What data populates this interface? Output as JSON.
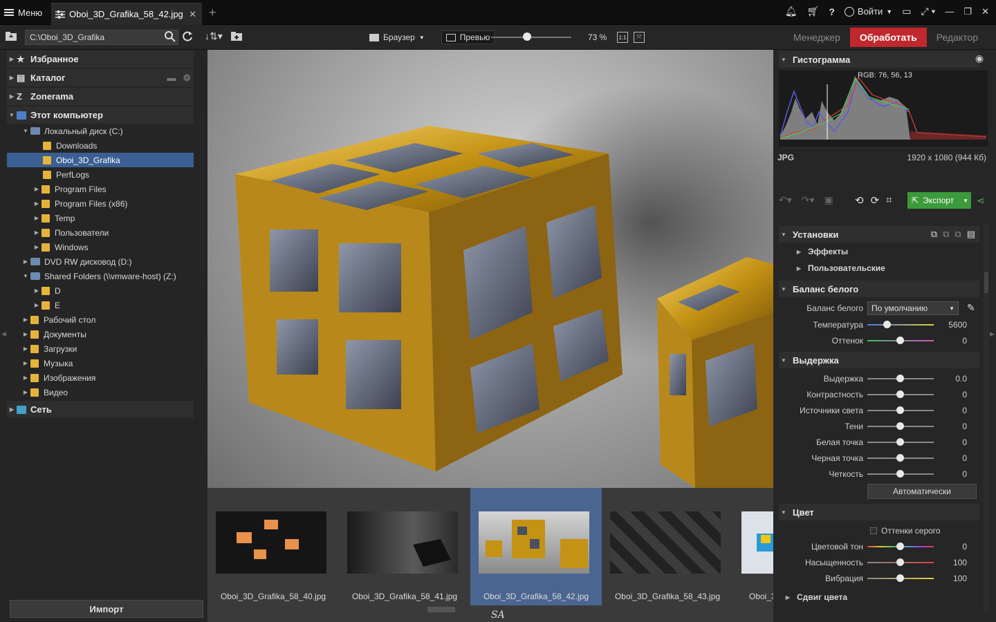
{
  "topbar": {
    "menu_label": "Меню",
    "tab_title": "Oboi_3D_Grafika_58_42.jpg",
    "close_glyph": "✕",
    "new_tab_glyph": "+",
    "login_label": "Войти"
  },
  "toolbar": {
    "path_value": "C:\\Oboi_3D_Grafika",
    "browser_label": "Браузер",
    "preview_label": "Превью",
    "zoom_percent": 73,
    "zoom_label": "73 %",
    "one_to_one": "1:1",
    "modes": [
      "Менеджер",
      "Обработать",
      "Редактор"
    ]
  },
  "nav": {
    "sections": [
      "Избранное",
      "Каталог",
      "Zonerama",
      "Этот компьютер",
      "Сеть"
    ],
    "tree": [
      {
        "label": "Локальный диск (C:)"
      },
      {
        "label": "Downloads"
      },
      {
        "label": "Oboi_3D_Grafika"
      },
      {
        "label": "PerfLogs"
      },
      {
        "label": "Program Files"
      },
      {
        "label": "Program Files (x86)"
      },
      {
        "label": "Temp"
      },
      {
        "label": "Пользователи"
      },
      {
        "label": "Windows"
      },
      {
        "label": "DVD RW дисковод (D:)"
      },
      {
        "label": "Shared Folders (\\\\vmware-host) (Z:)"
      },
      {
        "label": "D"
      },
      {
        "label": "E"
      },
      {
        "label": "Рабочий стол"
      },
      {
        "label": "Документы"
      },
      {
        "label": "Загрузки"
      },
      {
        "label": "Музыка"
      },
      {
        "label": "Изображения"
      },
      {
        "label": "Видео"
      }
    ],
    "import_label": "Импорт"
  },
  "filmstrip": {
    "items": [
      "Oboi_3D_Grafika_58_40.jpg",
      "Oboi_3D_Grafika_58_41.jpg",
      "Oboi_3D_Grafika_58_42.jpg",
      "Oboi_3D_Grafika_58_43.jpg",
      "Oboi_3"
    ]
  },
  "signature": "SA",
  "right": {
    "histogram_title": "Гистограмма",
    "rgb_readout": "RGB: 76, 56, 13",
    "format": "JPG",
    "dimensions": "1920 x 1080 (944 Кб)",
    "export_label": "Экспорт",
    "presets_title": "Установки",
    "effects_label": "Эффекты",
    "custom_label": "Пользовательские",
    "wb_title": "Баланс белого",
    "wb_label": "Баланс белого",
    "wb_value": "По умолчанию",
    "temp_label": "Температура",
    "temp_value": "5600",
    "tint_label": "Оттенок",
    "tint_value": "0",
    "exposure_title": "Выдержка",
    "exposure_rows": [
      {
        "label": "Выдержка",
        "value": "0.0"
      },
      {
        "label": "Контрастность",
        "value": "0"
      },
      {
        "label": "Источники света",
        "value": "0"
      },
      {
        "label": "Тени",
        "value": "0"
      },
      {
        "label": "Белая точка",
        "value": "0"
      },
      {
        "label": "Черная точка",
        "value": "0"
      },
      {
        "label": "Четкость",
        "value": "0"
      }
    ],
    "auto_label": "Автоматически",
    "color_title": "Цвет",
    "grayscale_label": "Оттенки серого",
    "color_rows": [
      {
        "label": "Цветовой тон",
        "value": "0"
      },
      {
        "label": "Насыщенность",
        "value": "100"
      },
      {
        "label": "Вибрация",
        "value": "100"
      }
    ],
    "shift_title": "Сдвиг цвета"
  },
  "colors": {
    "accent_red": "#c0282d",
    "export_green": "#3b9a3b",
    "selection_blue": "#3b5f93",
    "folder_yellow": "#e4b33b"
  }
}
